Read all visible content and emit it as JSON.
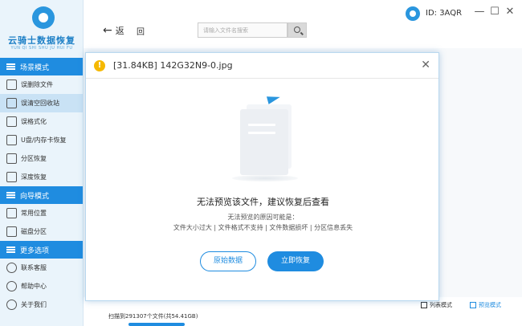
{
  "app": {
    "logo_title": "云骑士数据恢复",
    "logo_subtitle": "YUN QI SHI SHU JU HUI FU",
    "user_id": "ID: 3AQR",
    "accent_color": "#1f8ce0"
  },
  "sidebar": {
    "sections": [
      {
        "label": "场景模式",
        "items": [
          "误删除文件",
          "误清空回收站",
          "误格式化",
          "U盘/内存卡恢复",
          "分区恢复",
          "深度恢复"
        ]
      },
      {
        "label": "向导模式",
        "items": [
          "常用位置",
          "磁盘分区"
        ]
      },
      {
        "label": "更多选项",
        "items": [
          "联系客服",
          "帮助中心",
          "关于我们"
        ]
      }
    ],
    "active_item": "误清空回收站"
  },
  "toolbar": {
    "back_label": "返",
    "home_label": "回",
    "search_placeholder": "请输入文件名搜索"
  },
  "window_controls": {
    "minimize": "—",
    "maximize": "☐",
    "close": "✕"
  },
  "modal": {
    "title": "[31.84KB] 142G32N9-0.jpg",
    "message": "无法预览该文件，建议恢复后查看",
    "reason_title": "无法预览的原因可能是：",
    "reasons": "文件大小过大 | 文件格式不支持 | 文件数据损坏 | 分区信息丢失",
    "btn_raw": "原始数据",
    "btn_recover": "立即恢复",
    "close_icon": "close-icon"
  },
  "footer": {
    "status": "扫描到291307个文件(共54.41GB)",
    "view_list": "列表模式",
    "view_preview": "预览模式"
  }
}
